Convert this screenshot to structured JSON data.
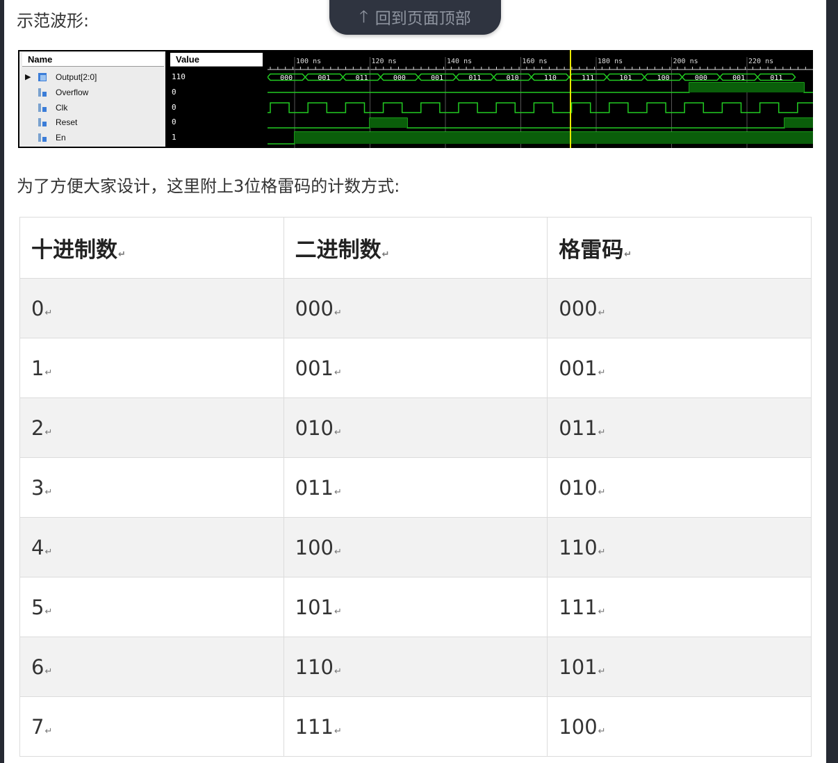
{
  "intro_text": "示范波形:",
  "back_to_top": {
    "label": "回到页面顶部",
    "icon": "arrow-up-icon"
  },
  "waveform": {
    "headers": {
      "name": "Name",
      "value": "Value"
    },
    "signals": [
      {
        "name": "Output[2:0]",
        "value": "110",
        "icon": "bus-icon",
        "expandable": true
      },
      {
        "name": "Overflow",
        "value": "0",
        "icon": "signal-icon"
      },
      {
        "name": "Clk",
        "value": "0",
        "icon": "signal-icon"
      },
      {
        "name": "Reset",
        "value": "0",
        "icon": "signal-icon"
      },
      {
        "name": "En",
        "value": "1",
        "icon": "signal-icon"
      }
    ],
    "time_labels": [
      "100 ns",
      "120 ns",
      "140 ns",
      "160 ns",
      "180 ns",
      "200 ns",
      "220 ns"
    ],
    "bus_values": [
      "000",
      "001",
      "011",
      "000",
      "001",
      "011",
      "010",
      "110",
      "111",
      "101",
      "100",
      "000",
      "001",
      "011"
    ],
    "trace_color": "#22cc22",
    "cursor_color": "#e8e800"
  },
  "table_intro": "为了方便大家设计，这里附上3位格雷码的计数方式:",
  "table": {
    "headers": [
      "十进制数",
      "二进制数",
      "格雷码"
    ],
    "rows": [
      [
        "0",
        "000",
        "000"
      ],
      [
        "1",
        "001",
        "001"
      ],
      [
        "2",
        "010",
        "011"
      ],
      [
        "3",
        "011",
        "010"
      ],
      [
        "4",
        "100",
        "110"
      ],
      [
        "5",
        "101",
        "111"
      ],
      [
        "6",
        "110",
        "101"
      ],
      [
        "7",
        "111",
        "100"
      ]
    ],
    "paragraph_mark": "↵"
  }
}
